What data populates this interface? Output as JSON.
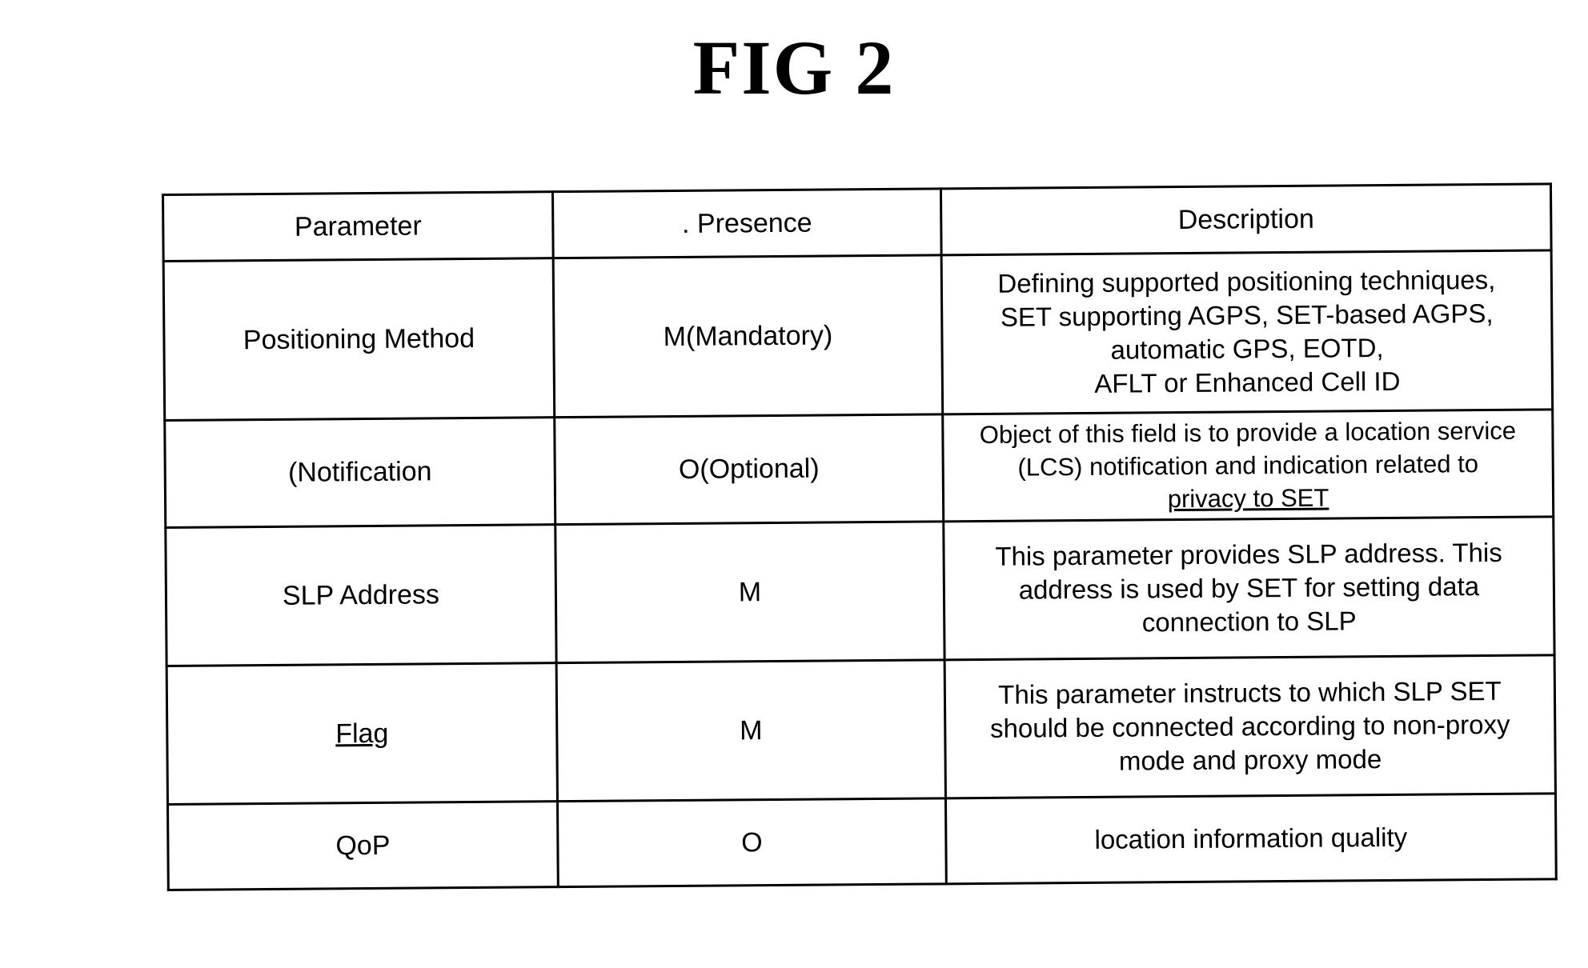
{
  "figure": {
    "title": "FIG 2"
  },
  "table": {
    "headers": {
      "parameter": "Parameter",
      "presence": ". Presence",
      "description": "Description"
    },
    "rows": [
      {
        "parameter": "Positioning Method",
        "presence": "M(Mandatory)",
        "description_lines": [
          "Defining supported positioning techniques,",
          "SET supporting AGPS, SET-based AGPS,",
          "automatic GPS, EOTD,",
          "AFLT or Enhanced Cell ID"
        ]
      },
      {
        "parameter": "(Notification",
        "presence": "O(Optional)",
        "description_lines": [
          "Object of this field is to provide a location service",
          "(LCS) notification and indication related to",
          "privacy to SET"
        ]
      },
      {
        "parameter": "SLP Address",
        "presence": "M",
        "description_lines": [
          "This parameter provides SLP address. This",
          "address is used by SET for setting data",
          "connection to SLP"
        ]
      },
      {
        "parameter": "Flag",
        "presence": "M",
        "description_lines": [
          "This parameter instructs to which SLP SET",
          "should be connected according to non-proxy",
          "mode and proxy mode"
        ]
      },
      {
        "parameter": "QoP",
        "presence": "O",
        "description_lines": [
          "location information quality"
        ]
      }
    ]
  }
}
